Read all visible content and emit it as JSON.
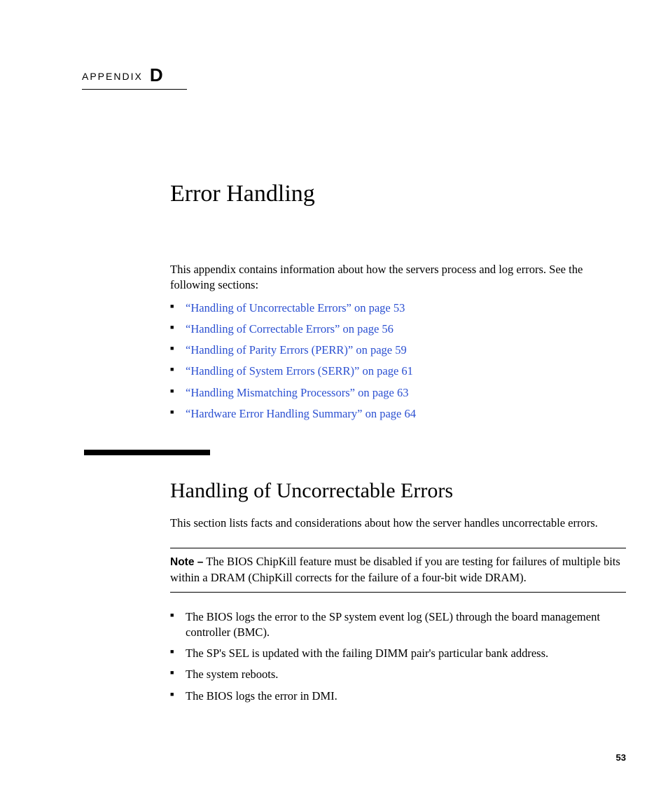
{
  "appendix": {
    "label": "APPENDIX",
    "letter": "D"
  },
  "chapter_title": "Error Handling",
  "intro": "This appendix contains information about how the servers process and log errors. See the following sections:",
  "links": [
    "“Handling of Uncorrectable Errors” on page 53",
    "“Handling of Correctable Errors” on page 56",
    "“Handling of Parity Errors (PERR)” on page 59",
    "“Handling of System Errors (SERR)” on page 61",
    "“Handling Mismatching Processors” on page 63",
    "“Hardware Error Handling Summary” on page 64"
  ],
  "section": {
    "title": "Handling of Uncorrectable Errors",
    "intro": "This section lists facts and considerations about how the server handles uncorrectable errors.",
    "note_label": "Note –",
    "note_body": " The BIOS ChipKill feature must be disabled if you are testing for failures of multiple bits within a DRAM (ChipKill corrects for the failure of a four-bit wide DRAM).",
    "facts": [
      "The BIOS logs the error to the SP system event log (SEL) through the board management controller (BMC).",
      "The SP's SEL is updated with the failing DIMM pair's particular bank address.",
      "The system reboots.",
      "The BIOS logs the error in DMI."
    ]
  },
  "page_number": "53"
}
